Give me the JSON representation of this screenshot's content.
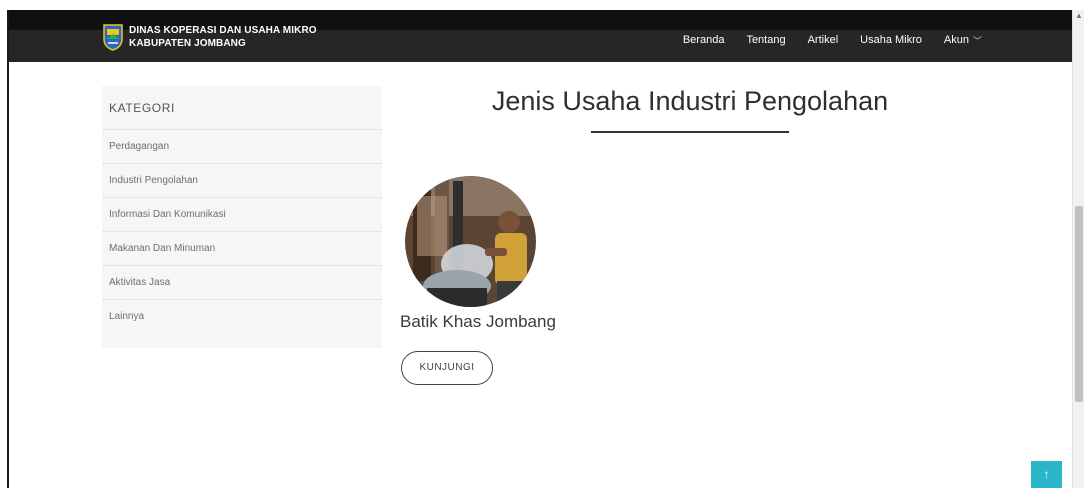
{
  "brand": {
    "line1": "DINAS KOPERASI DAN USAHA MIKRO",
    "line2": "KABUPATEN JOMBANG"
  },
  "nav": {
    "items": [
      "Beranda",
      "Tentang",
      "Artikel",
      "Usaha Mikro"
    ],
    "account_label": "Akun",
    "account_caret": "﹀"
  },
  "sidebar": {
    "title": "KATEGORI",
    "items": [
      "Perdagangan",
      "Industri Pengolahan",
      "Informasi Dan Komunikasi",
      "Makanan Dan Minuman",
      "Aktivitas Jasa",
      "Lainnya"
    ]
  },
  "main": {
    "title": "Jenis Usaha Industri Pengolahan",
    "business": {
      "name": "Batik Khas Jombang",
      "button_label": "KUNJUNGI"
    }
  },
  "back_to_top": {
    "glyph": "↑"
  },
  "colors": {
    "navbar": "#262626",
    "accent": "#29b6c9",
    "sidebar_bg": "#f6f6f6"
  },
  "icons": {
    "logo": "regency-shield-logo",
    "back_to_top": "arrow-up-icon",
    "account_caret": "chevron-down-icon"
  }
}
